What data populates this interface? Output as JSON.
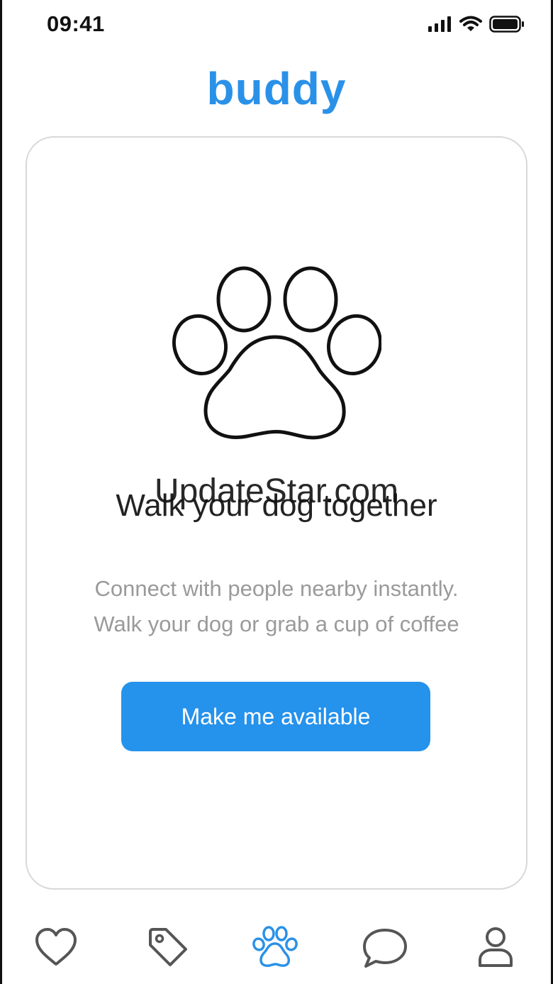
{
  "status_bar": {
    "time": "09:41",
    "icons": [
      "signal-icon",
      "wifi-icon",
      "battery-icon"
    ]
  },
  "app": {
    "title": "buddy",
    "accent_color": "#2a91e8"
  },
  "card": {
    "illustration": "paw-icon",
    "watermark": "UpdateStar.com",
    "headline": "Walk your dog together",
    "description_line_1": "Connect with people nearby instantly.",
    "description_line_2": "Walk your dog or grab a cup of coffee",
    "button_label": "Make me available"
  },
  "tab_bar": {
    "tabs": [
      {
        "icon": "heart-icon",
        "active": false
      },
      {
        "icon": "tag-icon",
        "active": false
      },
      {
        "icon": "paw-icon",
        "active": true
      },
      {
        "icon": "chat-bubble-icon",
        "active": false
      },
      {
        "icon": "user-icon",
        "active": false
      }
    ],
    "active_color": "#2a91e8",
    "inactive_color": "#555555"
  }
}
